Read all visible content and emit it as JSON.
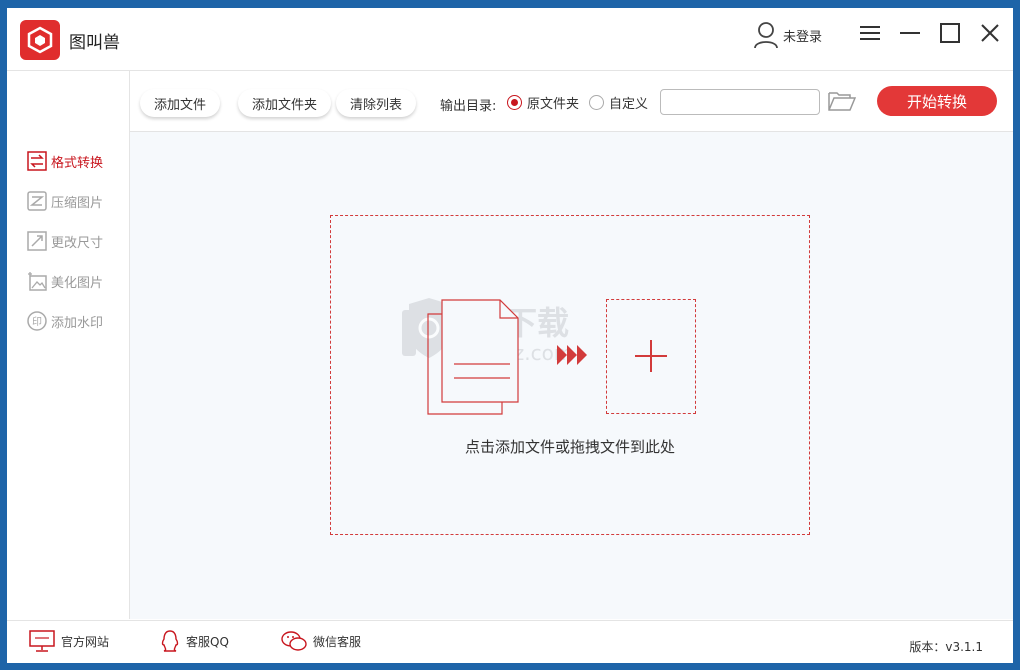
{
  "app": {
    "title": "图叫兽",
    "version": "版本：v3.1.1"
  },
  "header": {
    "user_label": "未登录"
  },
  "toolbar": {
    "add_file": "添加文件",
    "add_folder": "添加文件夹",
    "clear_list": "清除列表",
    "output_dir_label": "输出目录:",
    "option_original": "原文件夹",
    "option_custom": "自定义",
    "output_path_value": "",
    "start_button": "开始转换"
  },
  "sidebar": {
    "items": [
      {
        "label": "格式转换",
        "icon": "convert-icon",
        "active": true
      },
      {
        "label": "压缩图片",
        "icon": "compress-icon",
        "active": false
      },
      {
        "label": "更改尺寸",
        "icon": "resize-icon",
        "active": false
      },
      {
        "label": "美化图片",
        "icon": "beautify-icon",
        "active": false
      },
      {
        "label": "添加水印",
        "icon": "watermark-icon",
        "active": false
      }
    ]
  },
  "main": {
    "drop_hint": "点击添加文件或拖拽文件到此处",
    "watermark_text": "anxz.com"
  },
  "footer": {
    "official_site": "官方网站",
    "qq_service": "客服QQ",
    "wechat_service": "微信客服"
  },
  "colors": {
    "accent": "#c8161e",
    "start_button": "#e33838",
    "background": "#f6f9fc"
  }
}
